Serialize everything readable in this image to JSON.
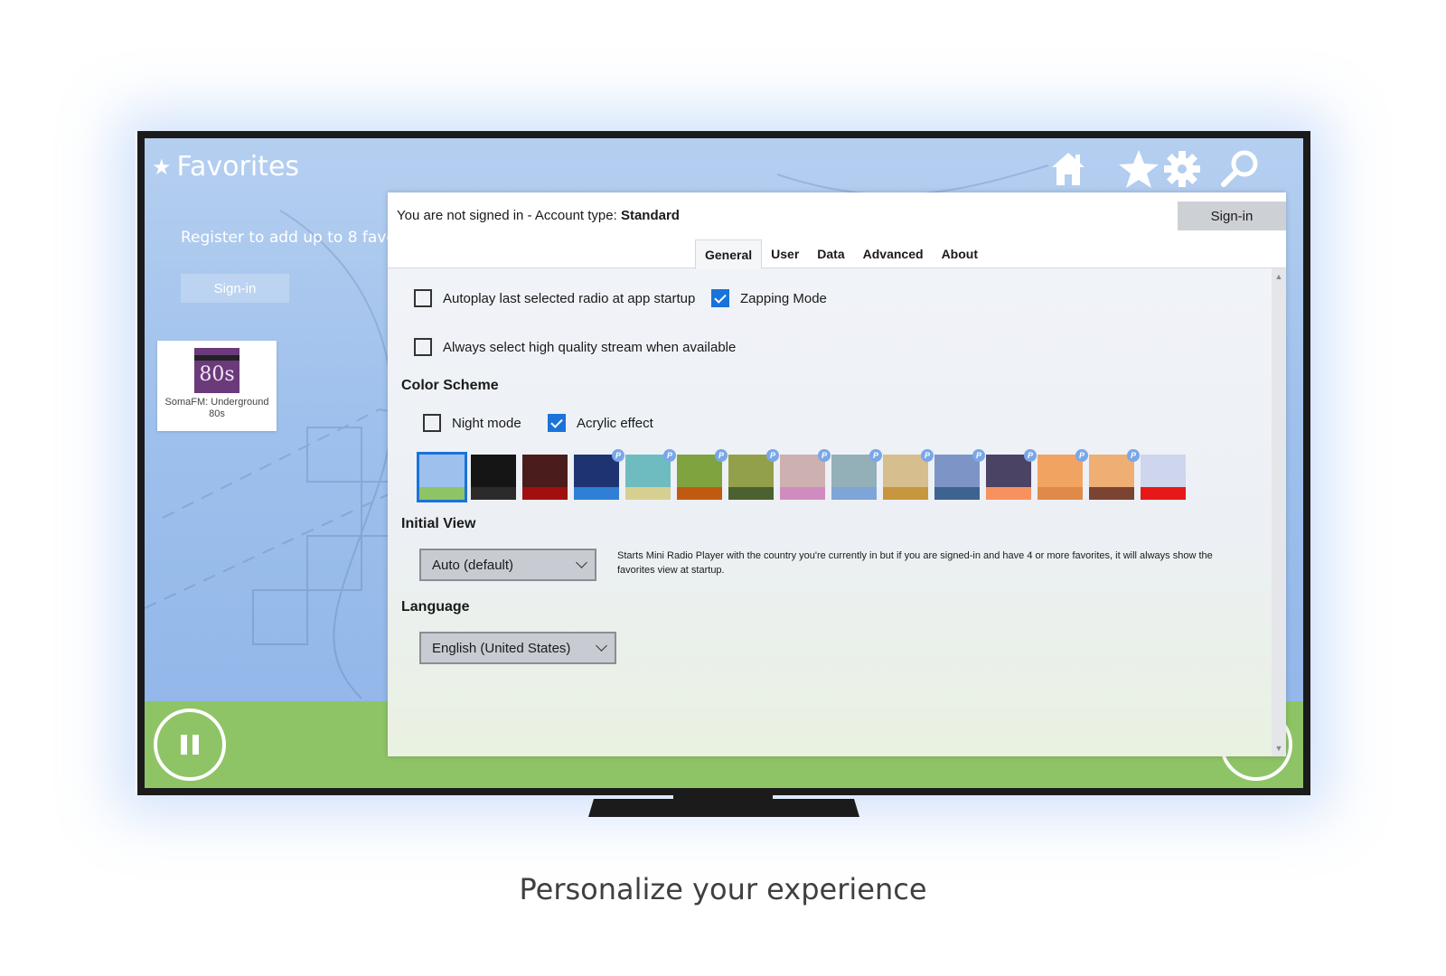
{
  "favorites": {
    "title": "Favorites",
    "register_text": "Register to add up to 8 favo",
    "signin_label": "Sign-in",
    "station": {
      "name": "SomaFM: Underground 80s",
      "logo_text": "80s"
    }
  },
  "header_icons": [
    "home-icon",
    "star-icon",
    "gear-icon",
    "search-icon"
  ],
  "dialog": {
    "account_prefix": "You are not signed in - Account type: ",
    "account_type": "Standard",
    "signin_label": "Sign-in",
    "tabs": [
      {
        "label": "General",
        "active": true
      },
      {
        "label": "User",
        "active": false
      },
      {
        "label": "Data",
        "active": false
      },
      {
        "label": "Advanced",
        "active": false
      },
      {
        "label": "About",
        "active": false
      }
    ],
    "options": {
      "autoplay": {
        "label": "Autoplay last selected radio at app startup",
        "checked": false
      },
      "zapping": {
        "label": "Zapping Mode",
        "checked": true
      },
      "high_quality": {
        "label": "Always select high quality stream when available",
        "checked": false
      }
    },
    "color_scheme": {
      "title": "Color Scheme",
      "night_mode": {
        "label": "Night mode",
        "checked": false
      },
      "acrylic": {
        "label": "Acrylic effect",
        "checked": true
      },
      "premium_badge": "P",
      "swatches": [
        {
          "top": "#9ec0ec",
          "bottom": "#8ec466",
          "premium": false,
          "selected": true
        },
        {
          "top": "#151515",
          "bottom": "#2b2b2b",
          "premium": false,
          "selected": false
        },
        {
          "top": "#4a1c1c",
          "bottom": "#a10f0f",
          "premium": false,
          "selected": false
        },
        {
          "top": "#1e3472",
          "bottom": "#2f7fd6",
          "premium": true,
          "selected": false
        },
        {
          "top": "#6fbcc0",
          "bottom": "#d6cf8f",
          "premium": true,
          "selected": false
        },
        {
          "top": "#7fa33f",
          "bottom": "#c05a10",
          "premium": true,
          "selected": false
        },
        {
          "top": "#93a04a",
          "bottom": "#4b6130",
          "premium": true,
          "selected": false
        },
        {
          "top": "#cdb0b0",
          "bottom": "#d08cc0",
          "premium": true,
          "selected": false
        },
        {
          "top": "#93b0b8",
          "bottom": "#7ea5d8",
          "premium": true,
          "selected": false
        },
        {
          "top": "#d6be8e",
          "bottom": "#c8963e",
          "premium": true,
          "selected": false
        },
        {
          "top": "#7d94c6",
          "bottom": "#3d6490",
          "premium": true,
          "selected": false
        },
        {
          "top": "#4a4364",
          "bottom": "#f7925e",
          "premium": true,
          "selected": false
        },
        {
          "top": "#f1a462",
          "bottom": "#e08a4a",
          "premium": true,
          "selected": false
        },
        {
          "top": "#eeae74",
          "bottom": "#7b4332",
          "premium": true,
          "selected": false
        },
        {
          "top": "#cdd6ec",
          "bottom": "#e81818",
          "premium": false,
          "selected": false
        }
      ]
    },
    "initial_view": {
      "title": "Initial View",
      "value": "Auto (default)",
      "help": "Starts Mini Radio Player with the country you're currently in but if you are signed-in and have 4 or more favorites, it will always show the favorites view at startup."
    },
    "language": {
      "title": "Language",
      "value": "English (United States)"
    }
  },
  "tagline": "Personalize your experience"
}
